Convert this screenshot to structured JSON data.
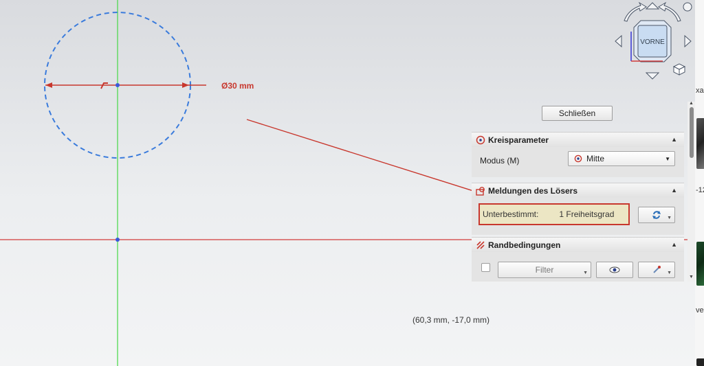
{
  "sketch": {
    "dimension_label": "Ø30 mm",
    "cursor_coordinates": "(60,3 mm, -17,0 mm)"
  },
  "navcube": {
    "face_label": "VORNE",
    "cube_icon": "3d-cube-icon"
  },
  "task_panel": {
    "close_label": "Schließen",
    "circle_params": {
      "title": "Kreisparameter",
      "icon": "circle-parameter-icon",
      "mode_label": "Modus (M)",
      "mode_value": "Mitte"
    },
    "solver": {
      "title": "Meldungen des Lösers",
      "icon": "solver-message-icon",
      "status_label": "Unterbestimmt:",
      "status_value": "1 Freiheitsgrad",
      "refresh_icon": "refresh-icon"
    },
    "constraints": {
      "title": "Randbedingungen",
      "icon": "constraints-icon",
      "filter_label": "Filter",
      "visibility_icon": "eye-icon",
      "settings_icon": "constraint-settings-icon"
    }
  },
  "edge_strip": {
    "texts": [
      "xa",
      "-12",
      "ve"
    ]
  },
  "colors": {
    "highlight_border": "#c8372d",
    "circle": "#3a7bdc",
    "x_axis": "#d23a3a",
    "y_axis": "#44d844",
    "dimension": "#c8372d"
  }
}
